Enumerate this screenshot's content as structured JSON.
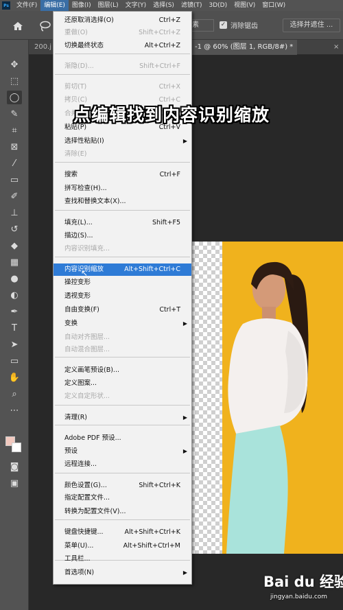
{
  "menubar": {
    "logo": "Ps",
    "items": [
      "文件(F)",
      "编辑(E)",
      "图像(I)",
      "图层(L)",
      "文字(Y)",
      "选择(S)",
      "滤镜(T)",
      "3D(D)",
      "视图(V)",
      "窗口(W)"
    ]
  },
  "options_bar": {
    "box_text": "素",
    "checkbox_label": "消除锯齿",
    "select_subject": "选择并遮住 ..."
  },
  "tabs": [
    "200.j",
    "-1 @ 60% (图层 1, RGB/8#) *",
    "×"
  ],
  "menu": {
    "items": [
      {
        "label": "还原取消选择(O)",
        "shortcut": "Ctrl+Z",
        "disabled": false
      },
      {
        "label": "重做(O)",
        "shortcut": "Shift+Ctrl+Z",
        "disabled": true
      },
      {
        "label": "切换最终状态",
        "shortcut": "Alt+Ctrl+Z",
        "disabled": false
      },
      {
        "label": "渐隐(D)...",
        "shortcut": "Shift+Ctrl+F",
        "disabled": true
      },
      {
        "label": "剪切(T)",
        "shortcut": "Ctrl+X",
        "disabled": true
      },
      {
        "label": "拷贝(C)",
        "shortcut": "Ctrl+C",
        "disabled": true
      },
      {
        "label": "合并拷贝(Y)",
        "shortcut": "Shift+Ctrl+C",
        "disabled": true
      },
      {
        "label": "粘贴(P)",
        "shortcut": "Ctrl+V",
        "disabled": false
      },
      {
        "label": "选择性粘贴(I)",
        "shortcut": "",
        "disabled": false,
        "submenu": true
      },
      {
        "label": "清除(E)",
        "shortcut": "",
        "disabled": true
      },
      {
        "label": "搜索",
        "shortcut": "Ctrl+F",
        "disabled": false
      },
      {
        "label": "拼写检查(H)...",
        "shortcut": "",
        "disabled": false
      },
      {
        "label": "查找和替换文本(X)...",
        "shortcut": "",
        "disabled": false
      },
      {
        "label": "填充(L)...",
        "shortcut": "Shift+F5",
        "disabled": false
      },
      {
        "label": "描边(S)...",
        "shortcut": "",
        "disabled": false
      },
      {
        "label": "内容识别填充...",
        "shortcut": "",
        "disabled": true
      },
      {
        "label": "内容识别缩放",
        "shortcut": "Alt+Shift+Ctrl+C",
        "disabled": false,
        "highlighted": true
      },
      {
        "label": "操控变形",
        "shortcut": "",
        "disabled": false
      },
      {
        "label": "透视变形",
        "shortcut": "",
        "disabled": false
      },
      {
        "label": "自由变换(F)",
        "shortcut": "Ctrl+T",
        "disabled": false
      },
      {
        "label": "变换",
        "shortcut": "",
        "disabled": false,
        "submenu": true
      },
      {
        "label": "自动对齐图层...",
        "shortcut": "",
        "disabled": true
      },
      {
        "label": "自动混合图层...",
        "shortcut": "",
        "disabled": true
      },
      {
        "label": "定义画笔预设(B)...",
        "shortcut": "",
        "disabled": false
      },
      {
        "label": "定义图案...",
        "shortcut": "",
        "disabled": false
      },
      {
        "label": "定义自定形状...",
        "shortcut": "",
        "disabled": true
      },
      {
        "label": "清理(R)",
        "shortcut": "",
        "disabled": false,
        "submenu": true
      },
      {
        "label": "Adobe PDF 预设...",
        "shortcut": "",
        "disabled": false
      },
      {
        "label": "预设",
        "shortcut": "",
        "disabled": false,
        "submenu": true
      },
      {
        "label": "远程连接...",
        "shortcut": "",
        "disabled": false
      },
      {
        "label": "颜色设置(G)...",
        "shortcut": "Shift+Ctrl+K",
        "disabled": false
      },
      {
        "label": "指定配置文件...",
        "shortcut": "",
        "disabled": false
      },
      {
        "label": "转换为配置文件(V)...",
        "shortcut": "",
        "disabled": false
      },
      {
        "label": "键盘快捷键...",
        "shortcut": "Alt+Shift+Ctrl+K",
        "disabled": false
      },
      {
        "label": "菜单(U)...",
        "shortcut": "Alt+Shift+Ctrl+M",
        "disabled": false
      },
      {
        "label": "工具栏...",
        "shortcut": "",
        "disabled": false
      },
      {
        "label": "首选项(N)",
        "shortcut": "",
        "disabled": false,
        "submenu": true
      }
    ]
  },
  "caption": "点编辑找到内容识别缩放",
  "watermark": {
    "main": "Bai du 经验",
    "sub": "jingyan.baidu.com"
  },
  "colors": {
    "menu_highlight": "#2e7bd6",
    "photo_bg": "#f0b21d",
    "skirt": "#a9e3db"
  }
}
